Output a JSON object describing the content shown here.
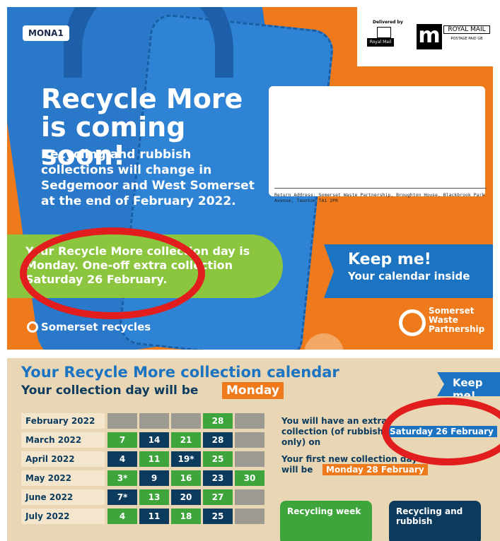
{
  "card_top": {
    "code": "MONA1",
    "headline": "Recycle More is coming soon!",
    "subline": "Recycling and rubbish collections will change in Sedgemoor and West Somerset at the end of February 2022.",
    "banner": "Your Recycle More collection day is Monday. One-off extra collection Saturday 26 February.",
    "recycles_logo": "Somerset recycles",
    "postage": {
      "delivered_by": "Delivered by",
      "royal_mail_small": "Royal Mail",
      "m_glyph": "m",
      "royal_mail": "ROYAL MAIL",
      "postage_paid": "POSTAGE PAID GB"
    },
    "return_address": "Return Address: Somerset Waste Partnership, Broughton House, Blackbrook Park Avenue, Taunton  TA1 2PR",
    "keep_title": "Keep me!",
    "keep_sub": "Your calendar inside",
    "partner_logo": "Somerset Waste Partnership"
  },
  "calendar": {
    "title": "Your Recycle More collection calendar",
    "day_line": "Your collection day will be",
    "day_chip": "Monday",
    "keep": "Keep me!",
    "months": [
      {
        "label": "February 2022",
        "cells": [
          {
            "t": "",
            "c": "grey"
          },
          {
            "t": "",
            "c": "grey"
          },
          {
            "t": "",
            "c": "grey"
          },
          {
            "t": "28",
            "c": "green"
          },
          {
            "t": "",
            "c": "grey"
          }
        ]
      },
      {
        "label": "March 2022",
        "cells": [
          {
            "t": "7",
            "c": "green"
          },
          {
            "t": "14",
            "c": "dark"
          },
          {
            "t": "21",
            "c": "green"
          },
          {
            "t": "28",
            "c": "dark"
          },
          {
            "t": "",
            "c": "grey"
          }
        ]
      },
      {
        "label": "April 2022",
        "cells": [
          {
            "t": "4",
            "c": "dark"
          },
          {
            "t": "11",
            "c": "green"
          },
          {
            "t": "19*",
            "c": "dark"
          },
          {
            "t": "25",
            "c": "green"
          },
          {
            "t": "",
            "c": "grey"
          }
        ]
      },
      {
        "label": "May 2022",
        "cells": [
          {
            "t": "3*",
            "c": "green"
          },
          {
            "t": "9",
            "c": "dark"
          },
          {
            "t": "16",
            "c": "green"
          },
          {
            "t": "23",
            "c": "dark"
          },
          {
            "t": "30",
            "c": "green"
          }
        ]
      },
      {
        "label": "June 2022",
        "cells": [
          {
            "t": "7*",
            "c": "dark"
          },
          {
            "t": "13",
            "c": "green"
          },
          {
            "t": "20",
            "c": "dark"
          },
          {
            "t": "27",
            "c": "green"
          },
          {
            "t": "",
            "c": "grey"
          }
        ]
      },
      {
        "label": "July 2022",
        "cells": [
          {
            "t": "4",
            "c": "green"
          },
          {
            "t": "11",
            "c": "dark"
          },
          {
            "t": "18",
            "c": "green"
          },
          {
            "t": "25",
            "c": "dark"
          },
          {
            "t": "",
            "c": "grey"
          }
        ]
      }
    ],
    "info_1": "You will have an extra collection (of rubbish only) on",
    "info_1_chip": "Saturday 26 February",
    "info_2": "Your first new collection day will be",
    "info_2_chip": "Monday 28 February",
    "tile_recycling": "Recycling week",
    "tile_both": "Recycling and rubbish"
  }
}
